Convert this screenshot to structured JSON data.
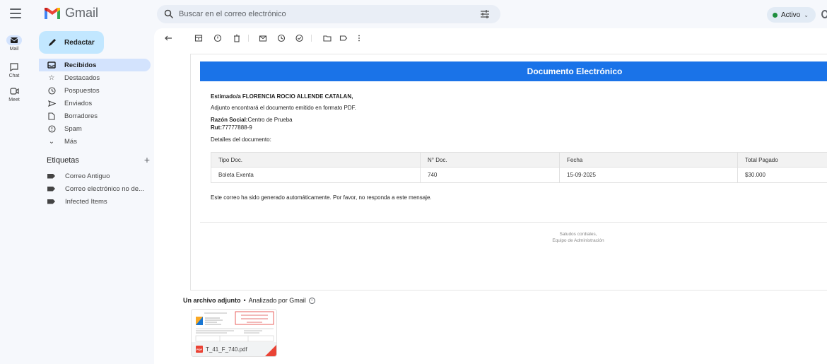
{
  "app": {
    "name": "Gmail"
  },
  "search": {
    "placeholder": "Buscar en el correo electrónico"
  },
  "status": {
    "label": "Activo"
  },
  "rail": [
    {
      "label": "Mail"
    },
    {
      "label": "Chat"
    },
    {
      "label": "Meet"
    }
  ],
  "compose": {
    "label": "Redactar"
  },
  "nav": [
    {
      "label": "Recibidos",
      "icon": "inbox-icon"
    },
    {
      "label": "Destacados",
      "icon": "star-icon"
    },
    {
      "label": "Pospuestos",
      "icon": "clock-icon"
    },
    {
      "label": "Enviados",
      "icon": "send-icon"
    },
    {
      "label": "Borradores",
      "icon": "draft-icon"
    },
    {
      "label": "Spam",
      "icon": "spam-icon"
    },
    {
      "label": "Más",
      "icon": "chevron-down-icon"
    }
  ],
  "labels": {
    "title": "Etiquetas",
    "items": [
      {
        "label": "Correo Antiguo"
      },
      {
        "label": "Correo electrónico no de..."
      },
      {
        "label": "Infected Items"
      }
    ]
  },
  "email": {
    "header": "Documento Electrónico",
    "greeting": "Estimado/a FLORENCIA ROCIO ALLENDE CATALAN,",
    "intro": "Adjunto encontrará el documento emitido en formato PDF.",
    "razon_label": "Razón Social:",
    "razon_value": "Centro de Prueba",
    "rut_label": "Rut:",
    "rut_value": "77777888-9",
    "details_label": "Detalles del documento:",
    "table": {
      "headers": [
        "Tipo Doc.",
        "N° Doc.",
        "Fecha",
        "Total Pagado"
      ],
      "rows": [
        [
          "Boleta Exenta",
          "740",
          "15-09-2025",
          "$30.000"
        ]
      ]
    },
    "auto_note": "Este correo ha sido generado automáticamente. Por favor, no responda a este mensaje.",
    "signoff_1": "Saludos cordiales,",
    "signoff_2": "Equipo de Administración"
  },
  "attachment": {
    "title": "Un archivo adjunto",
    "separator": "•",
    "scanned": "Analizado por Gmail",
    "filename": "T_41_F_740.pdf",
    "type_badge": "PDF"
  },
  "colors": {
    "accent": "#1a73e8",
    "nav_active": "#d3e3fd",
    "compose": "#c2e7ff",
    "status_dot": "#1e8e3e"
  }
}
